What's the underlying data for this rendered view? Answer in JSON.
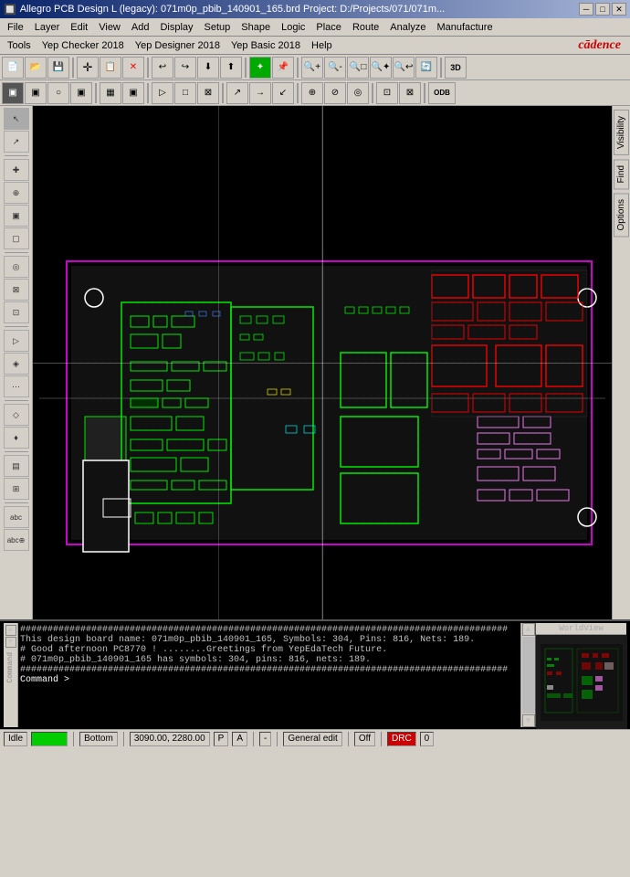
{
  "titlebar": {
    "icon": "🔲",
    "title": "Allegro PCB Design L (legacy): 071m0p_pbib_140901_165.brd  Project: D:/Projects/071/071m...",
    "minimize": "─",
    "maximize": "□",
    "close": "✕"
  },
  "menubar1": {
    "items": [
      "File",
      "Layer",
      "Edit",
      "View",
      "Add",
      "Display",
      "Setup",
      "Shape",
      "Logic",
      "Place",
      "Route",
      "Analyze",
      "Manufacture"
    ]
  },
  "menubar2": {
    "items": [
      "Tools",
      "Yep Checker 2018",
      "Yep Designer 2018",
      "Yep Basic 2018",
      "Help"
    ],
    "logo": "cādence"
  },
  "right_tabs": [
    "Visibility",
    "Find",
    "Options"
  ],
  "console": {
    "lines": [
      "################################################################################",
      "This design board name: 071m0p_pbib_140901_165, Symbols: 304, Pins: 816, Nets: 189.",
      "#  Good afternoon PC8770 !          ........Greetings from YepEdaTech Future.",
      "#  071m0p_pbib_140901_165 has symbols: 304, pins: 816, nets: 189.",
      "################################################################################",
      "Command >"
    ]
  },
  "statusbar": {
    "idle": "Idle",
    "indicator": "",
    "layer": "Bottom",
    "coordinates": "3090.00, 2280.00",
    "P": "P",
    "A": "A",
    "dash": "-",
    "mode": "General edit",
    "off": "Off",
    "indicator2": "DRC",
    "zero": "0"
  },
  "toolbar1": {
    "buttons": [
      "📂",
      "💾",
      "🖨",
      "✂",
      "📋",
      "↩",
      "↪",
      "⬇",
      "⬆",
      "✦",
      "📌",
      "🔍",
      "🔍",
      "🔍",
      "🔍",
      "🔍",
      "🔍",
      "3D"
    ]
  },
  "toolbar2": {
    "buttons": [
      "▣",
      "▣",
      "○",
      "▣",
      "▦",
      "▣",
      "▣",
      "▶",
      "□",
      "⊠",
      "↗",
      "→",
      "↙",
      "⊕",
      "⊘",
      "◎",
      "⊡",
      "⊠",
      "ODB"
    ]
  },
  "left_toolbar": {
    "buttons": [
      "↖",
      "↗",
      "✚",
      "⊕",
      "▣",
      "▢",
      "◎",
      "⊠",
      "⊡",
      "▷",
      "◈",
      "⋯",
      "◇",
      "♦",
      "▤",
      "⊞",
      "abc",
      "abc+"
    ]
  },
  "minimap": {
    "label": "WorldView"
  }
}
